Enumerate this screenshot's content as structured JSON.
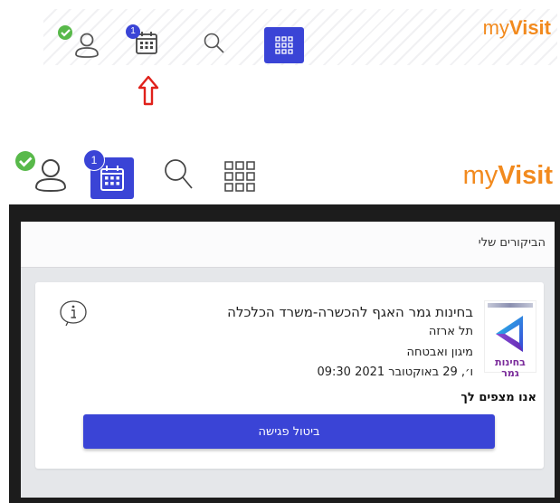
{
  "header_small": {
    "brand_prefix": "my",
    "brand_bold": "Visit",
    "calendar_badge": "1"
  },
  "header_large": {
    "brand_prefix": "my",
    "brand_bold": "Visit",
    "calendar_badge": "1"
  },
  "panel": {
    "title": "הביקורים שלי"
  },
  "appointment": {
    "title": "בחינות גמר האגף להכשרה-משרד הכלכלה",
    "location": "תל ארזה",
    "service": "מיגון ואבטחה",
    "datetime": "ו׳, 29 באוקטובר 2021 09:30",
    "logo_text": "בחינות גמר",
    "expecting_text": "אנו מצפים לך",
    "cancel_label": "ביטול פגישה"
  },
  "colors": {
    "brand": "#f28a1e",
    "accent": "#3a44d6",
    "status_ok": "#58b94a",
    "arrow": "#e0211b"
  }
}
